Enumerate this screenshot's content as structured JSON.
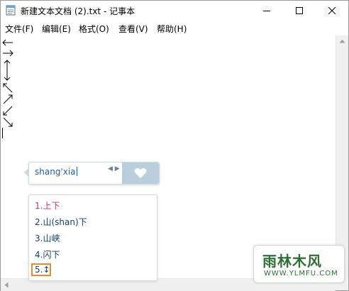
{
  "window": {
    "title": "新建文本文档 (2).txt - 记事本"
  },
  "menu": [
    "文件(F)",
    "编辑(E)",
    "格式(O)",
    "查看(V)",
    "帮助(H)"
  ],
  "ime": {
    "input": "shang'xia",
    "candidates": [
      "1.上下",
      "2.山(shan)下",
      "3.山峡",
      "4.闪下",
      "5.↕"
    ]
  },
  "watermark": {
    "title": "雨林木风",
    "url": "WWW.YLMFU.COM"
  },
  "colors": {
    "ime_text": "#1b5fb0",
    "candidate_first": "#c0396b",
    "highlight": "#e58a35",
    "watermark": "#2f6e35"
  }
}
